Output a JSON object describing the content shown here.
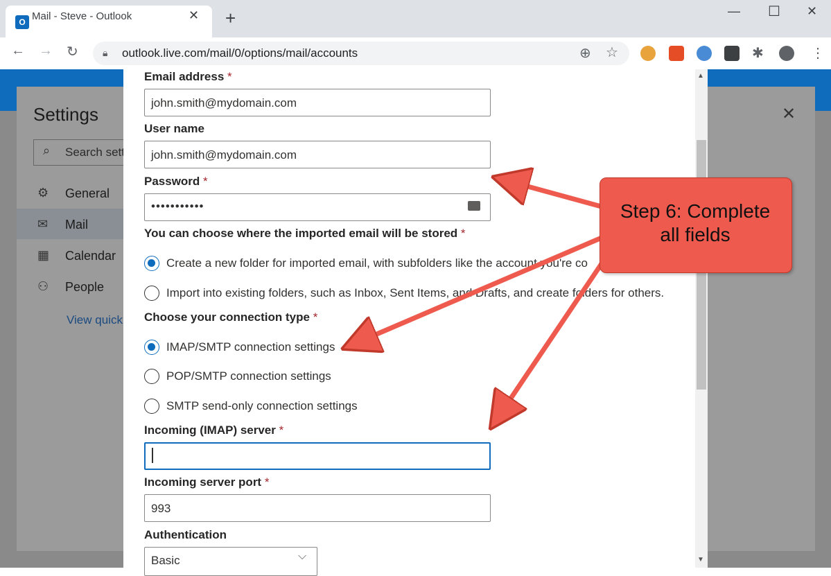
{
  "browser": {
    "tab_title": "Mail - Steve - Outlook",
    "tab_close": "✕",
    "new_tab": "+",
    "url": "outlook.live.com/mail/0/options/mail/accounts",
    "minimize": "—",
    "maximize": "☐",
    "close": "✕"
  },
  "settings": {
    "title": "Settings",
    "search_placeholder": "Search setti",
    "nav": [
      {
        "label": "General",
        "icon": "gear-icon"
      },
      {
        "label": "Mail",
        "icon": "mail-icon"
      },
      {
        "label": "Calendar",
        "icon": "calendar-icon"
      },
      {
        "label": "People",
        "icon": "people-icon"
      }
    ],
    "view_quick": "View quick"
  },
  "form": {
    "email_label": "Email address",
    "email_value": "john.smith@mydomain.com",
    "username_label": "User name",
    "username_value": "john.smith@mydomain.com",
    "password_label": "Password",
    "password_value": "•••••••••••",
    "store_label": "You can choose where the imported email will be stored",
    "store_options": [
      "Create a new folder for imported email, with subfolders like the account you're co",
      "Import into existing folders, such as Inbox, Sent Items, and Drafts, and create folders for others."
    ],
    "connection_label": "Choose your connection type",
    "connection_options": [
      "IMAP/SMTP connection settings",
      "POP/SMTP connection settings",
      "SMTP send-only connection settings"
    ],
    "incoming_server_label": "Incoming (IMAP) server",
    "incoming_server_value": "",
    "incoming_port_label": "Incoming server port",
    "incoming_port_value": "993",
    "auth_label": "Authentication",
    "auth_value": "Basic",
    "required_mark": "*"
  },
  "callout": {
    "line1": "Step 6: Complete",
    "line2": "all fields",
    "color": "#ef5a4f"
  }
}
